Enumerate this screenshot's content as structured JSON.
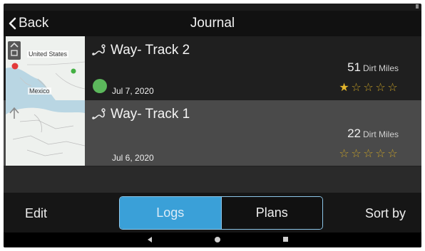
{
  "header": {
    "back_label": "Back",
    "title": "Journal"
  },
  "tracks": [
    {
      "name": "Way- Track 2",
      "date": "Jul 7, 2020",
      "miles": "51",
      "miles_unit": "Dirt Miles",
      "rating": 1,
      "rating_max": 5,
      "map_labels": [
        "United States",
        "Mexico"
      ],
      "status_color": "#5cb85c"
    },
    {
      "name": "Way- Track 1",
      "date": "Jul 6, 2020",
      "miles": "22",
      "miles_unit": "Dirt Miles",
      "rating": 0,
      "rating_max": 5
    }
  ],
  "bottom_bar": {
    "edit_label": "Edit",
    "logs_label": "Logs",
    "plans_label": "Plans",
    "sort_label": "Sort by",
    "active_segment": "Logs"
  },
  "colors": {
    "accent": "#3aa0d8",
    "star": "#e3b52c",
    "status_green": "#5cb85c"
  }
}
